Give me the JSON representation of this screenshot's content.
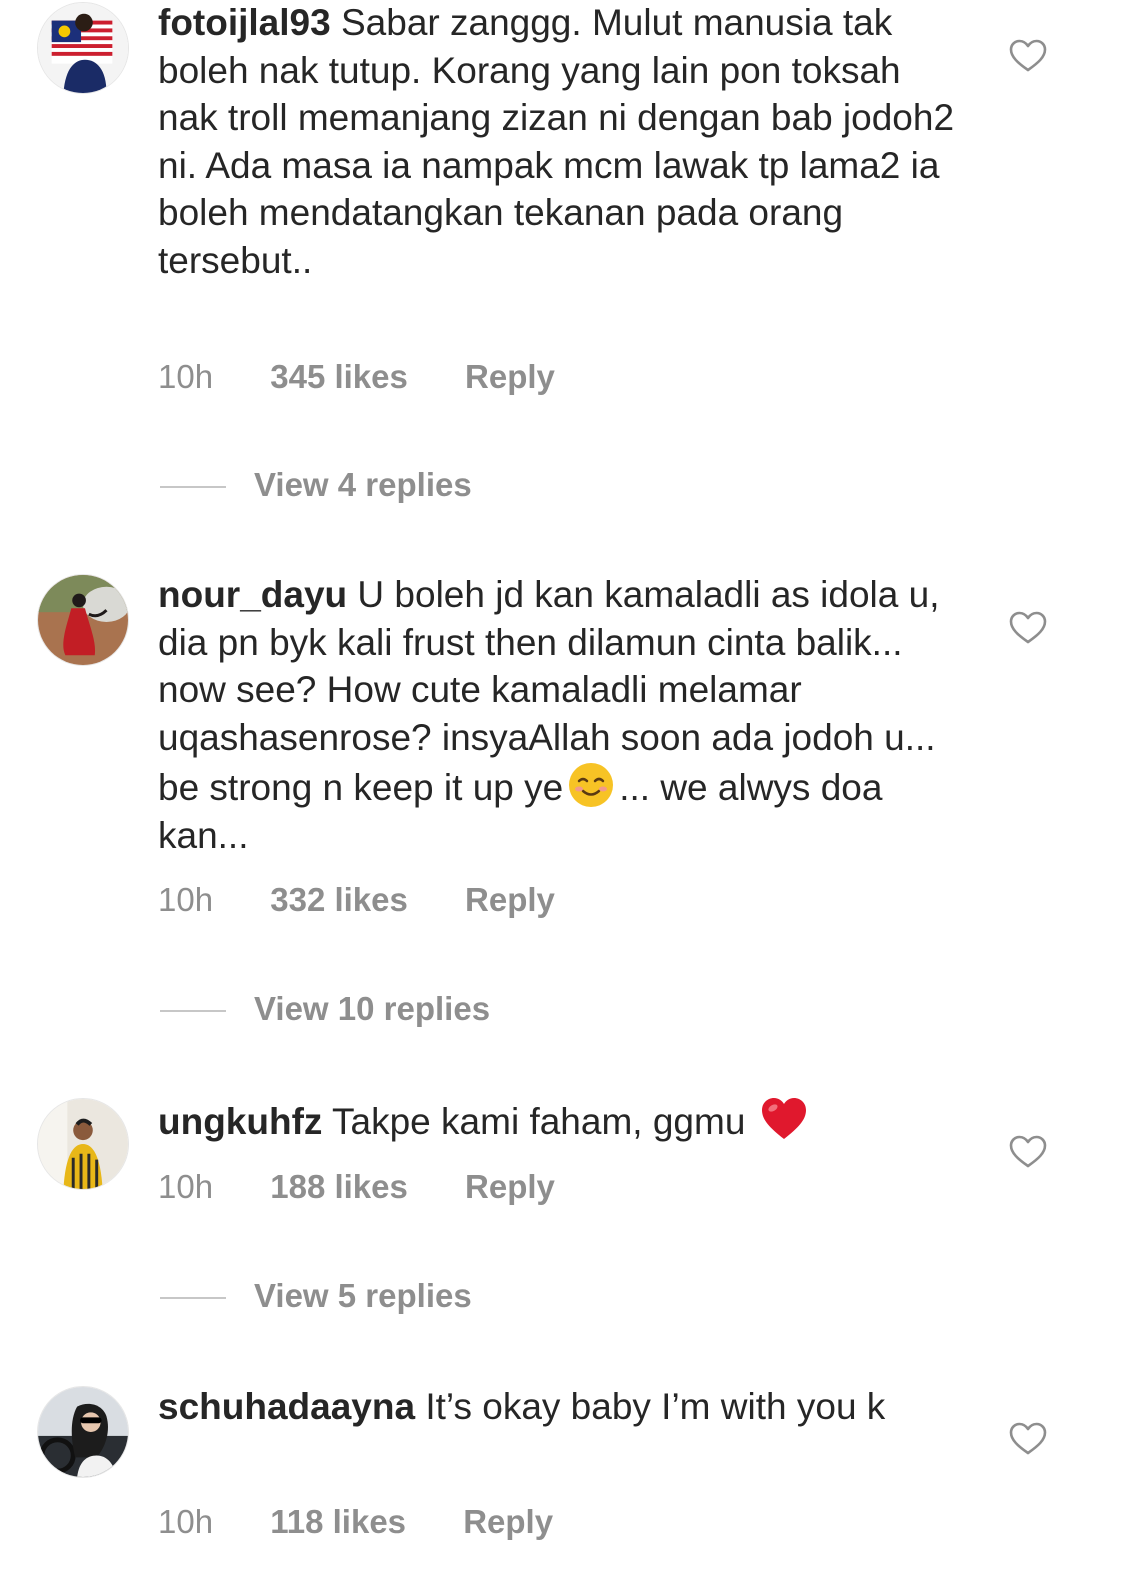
{
  "comments": [
    {
      "username": "fotoijlal93",
      "text": "Sabar zanggg. Mulut manusia tak boleh nak tutup. Korang yang lain pon toksah nak troll memanjang zizan ni dengan bab jodoh2 ni. Ada masa ia nampak mcm lawak tp lama2 ia boleh mendatangkan tekanan pada orang tersebut..",
      "time": "10h",
      "likes": "345 likes",
      "reply": "Reply",
      "view_replies": "View 4 replies",
      "avatar_icon": "profile-photo-flag"
    },
    {
      "username": "nour_dayu",
      "text_before_emoji": "U boleh jd kan kamaladli as idola u, dia pn byk kali frust then dilamun cinta balik... now see? How cute kamaladli melamar uqashasenrose? insyaAllah soon ada jodoh u... be strong n keep it up ye",
      "emoji": "smiling-face-emoji",
      "text_after_emoji": "... we alwys doa kan...",
      "time": "10h",
      "likes": "332 likes",
      "reply": "Reply",
      "view_replies": "View 10 replies",
      "avatar_icon": "profile-photo-red-dress"
    },
    {
      "username": "ungkuhfz",
      "text": "Takpe kami faham, ggmu",
      "emoji": "red-heart-emoji",
      "time": "10h",
      "likes": "188 likes",
      "reply": "Reply",
      "view_replies": "View 5 replies",
      "avatar_icon": "profile-photo-yellow-shirt"
    },
    {
      "username": "schuhadaayna",
      "text": "It’s okay baby I’m with you k",
      "time": "10h",
      "likes": "118 likes",
      "reply": "Reply",
      "avatar_icon": "profile-photo-car-selfie"
    }
  ],
  "icons": {
    "like": "heart-outline-icon"
  },
  "colors": {
    "text": "#262626",
    "meta": "#8e8e8e",
    "divider": "#c7c7c7",
    "heart_emoji": "#e0182d",
    "smile_emoji": "#f7c325"
  }
}
